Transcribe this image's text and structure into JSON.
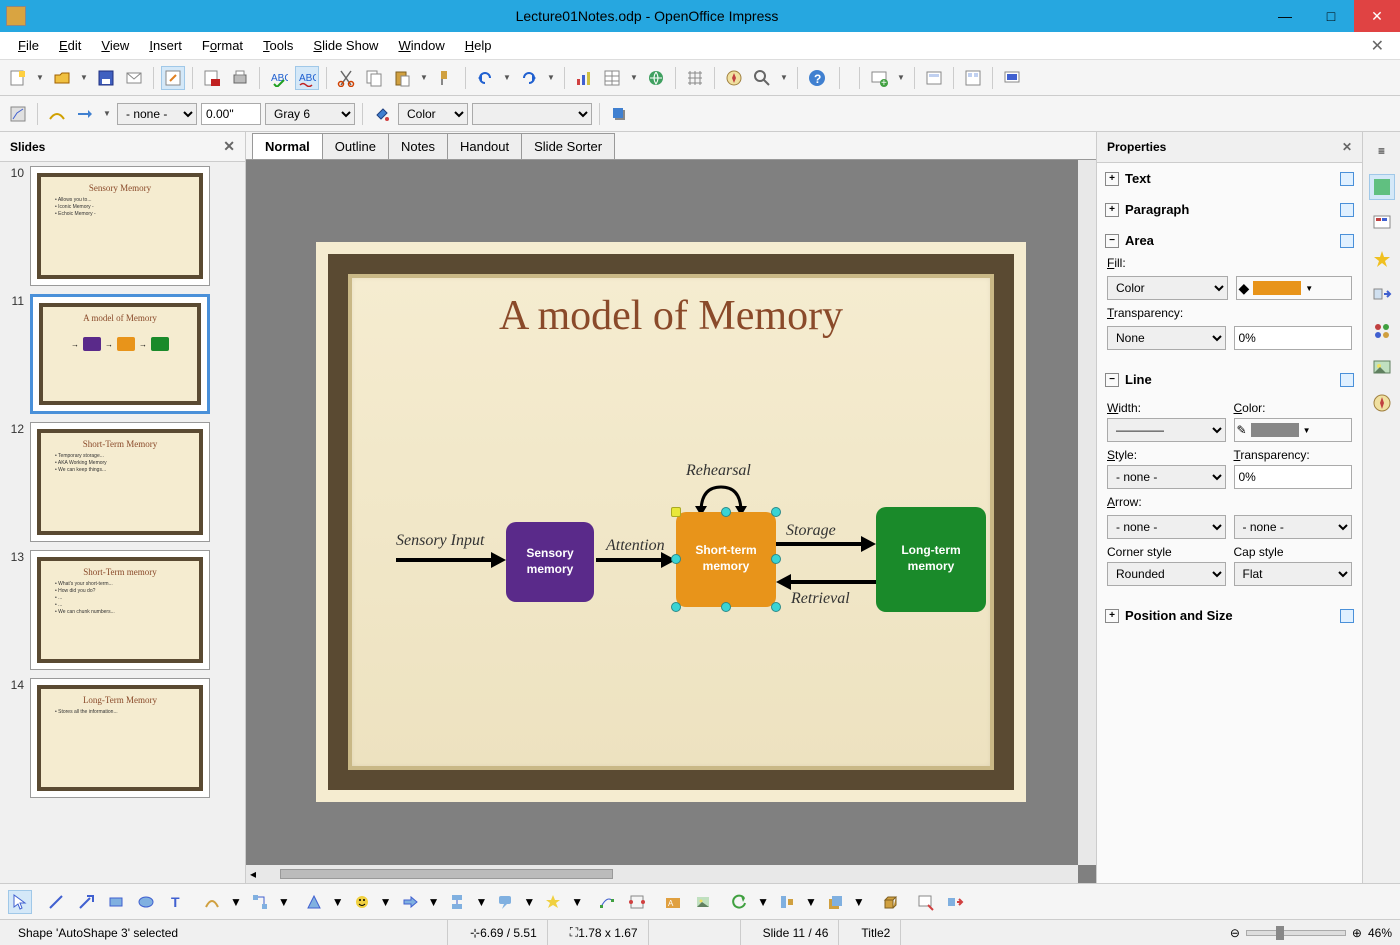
{
  "window": {
    "title": "Lecture01Notes.odp - OpenOffice Impress"
  },
  "menus": [
    "File",
    "Edit",
    "View",
    "Insert",
    "Format",
    "Tools",
    "Slide Show",
    "Window",
    "Help"
  ],
  "toolbar2": {
    "line_style": "- none -",
    "line_width": "0.00\"",
    "line_color": "Gray 6",
    "fill_mode": "Color",
    "fill_value": ""
  },
  "slides_panel": {
    "title": "Slides",
    "thumbs": [
      {
        "num": 10,
        "title": "Sensory Memory",
        "lines": [
          "• Allows you to...",
          "• Iconic Memory -",
          "• Echoic Memory -"
        ]
      },
      {
        "num": 11,
        "title": "A model of Memory",
        "diagram": true,
        "selected": true
      },
      {
        "num": 12,
        "title": "Short-Term Memory",
        "lines": [
          "• Temporary storage...",
          "• AKA Working Memory",
          "• We can keep things..."
        ]
      },
      {
        "num": 13,
        "title": "Short-Term memory",
        "lines": [
          "• What's your short-term...",
          "• How did you do?",
          "• ...",
          "• ...",
          "• We can chunk numbers..."
        ]
      },
      {
        "num": 14,
        "title": "Long-Term Memory",
        "lines": [
          "• Stores all the information..."
        ]
      }
    ]
  },
  "view_tabs": [
    "Normal",
    "Outline",
    "Notes",
    "Handout",
    "Slide Sorter"
  ],
  "slide": {
    "title": "A model of Memory",
    "boxes": {
      "sensory": "Sensory memory",
      "short": "Short-term memory",
      "long": "Long-term memory"
    },
    "labels": {
      "sensory_input": "Sensory Input",
      "attention": "Attention",
      "rehearsal": "Rehearsal",
      "storage": "Storage",
      "retrieval": "Retrieval"
    }
  },
  "properties": {
    "title": "Properties",
    "text": "Text",
    "paragraph": "Paragraph",
    "area": "Area",
    "fill_label": "Fill:",
    "fill_type": "Color",
    "fill_color": "#e8941a",
    "transparency_label": "Transparency:",
    "transparency_type": "None",
    "transparency_value": "0%",
    "line": "Line",
    "width_label": "Width:",
    "color_label": "Color:",
    "line_color": "#888888",
    "style_label": "Style:",
    "style_value": "- none -",
    "line_transparency_label": "Transparency:",
    "line_transparency_value": "0%",
    "arrow_label": "Arrow:",
    "arrow_start": "- none -",
    "arrow_end": "- none -",
    "corner_label": "Corner style",
    "corner_value": "Rounded",
    "cap_label": "Cap style",
    "cap_value": "Flat",
    "position_size": "Position and Size"
  },
  "status": {
    "selection": "Shape 'AutoShape 3' selected",
    "pos": "6.69 / 5.51",
    "size": "1.78 x 1.67",
    "slide_info": "Slide 11 / 46",
    "layout": "Title2",
    "zoom": "46%"
  }
}
